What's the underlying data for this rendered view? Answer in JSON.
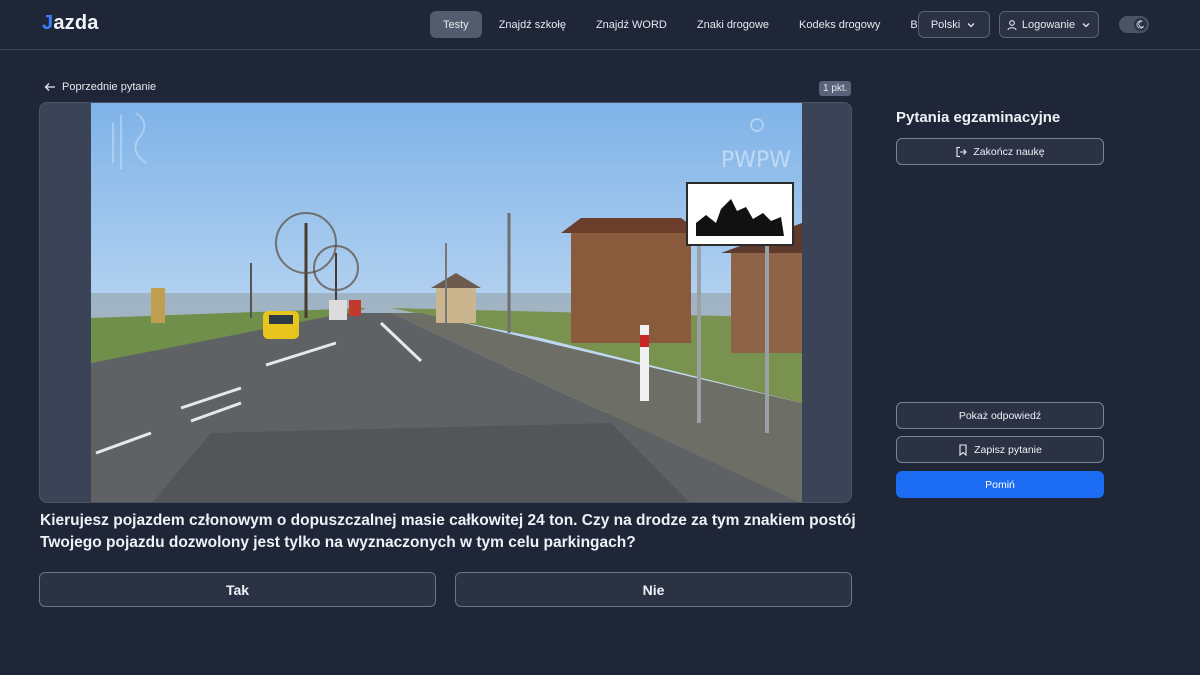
{
  "header": {
    "logo_letter": "J",
    "logo_rest": "azda",
    "nav": [
      {
        "label": "Testy",
        "active": true
      },
      {
        "label": "Znajdź szkołę"
      },
      {
        "label": "Znajdź WORD"
      },
      {
        "label": "Znaki drogowe"
      },
      {
        "label": "Kodeks drogowy"
      },
      {
        "label": "Blog"
      }
    ],
    "language": "Polski",
    "login": "Logowanie",
    "theme_icon": "moon-icon"
  },
  "question_panel": {
    "back_label": "Poprzednie pytanie",
    "points": "1 pkt.",
    "question": "Kierujesz pojazdem członowym o dopuszczalnej masie całkowitej 24 ton. Czy na drodze za tym znakiem postój Twojego pojazdu dozwolony jest tylko na wyznaczonych w tym celu parkingach?",
    "answers": [
      "Tak",
      "Nie"
    ],
    "image_watermark": "PWPW"
  },
  "sidebar": {
    "title": "Pytania egzaminacyjne",
    "finish_label": "Zakończ naukę",
    "show_answer_label": "Pokaż odpowiedź",
    "save_label": "Zapisz pytanie",
    "skip_label": "Pomiń"
  },
  "colors": {
    "background": "#1f2637",
    "accent": "#1b6cf2",
    "logo_accent": "#3b82f6"
  }
}
